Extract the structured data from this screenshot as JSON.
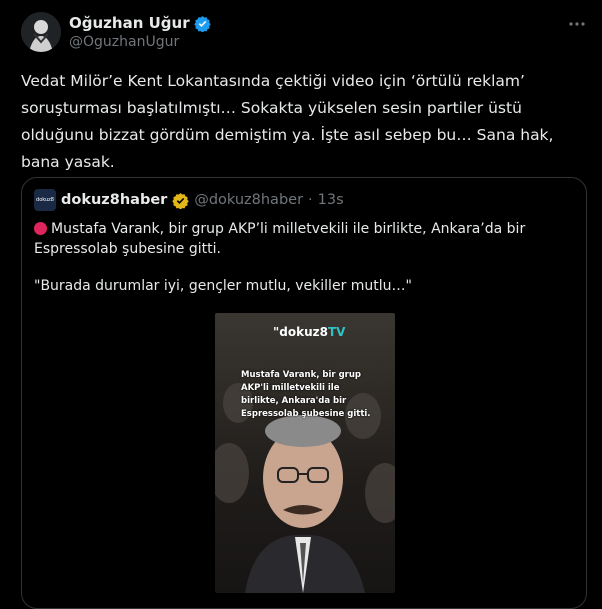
{
  "tweet": {
    "display_name": "Oğuzhan Uğur",
    "handle": "@OguzhanUgur",
    "more_icon": "more-icon",
    "text": "Vedat Milör’e Kent Lokantasında çektiği video için ‘örtülü reklam’ soruşturması başlatılmıştı… Sokakta yükselen sesin partiler üstü olduğunu bizzat gördüm demiştim ya. İşte asıl sebep bu… Sana hak, bana yasak."
  },
  "quote": {
    "avatar_text": "dokuz8",
    "display_name": "dokuz8haber",
    "handle": "@dokuz8haber",
    "separator": "·",
    "time": "13s",
    "line1": "Mustafa Varank, bir grup AKP’li milletvekili ile birlikte, Ankara’da bir Espressolab şubesine gitti.",
    "line2": "\"Burada durumlar iyi, gençler mutlu, vekiller mutlu…\"",
    "video": {
      "logo_main": "\"dokuz8",
      "logo_tv": "TV",
      "caption": "Mustafa Varank, bir grup AKP'li milletvekili ile birlikte, Ankara'da bir Espressolab şubesine gitti."
    }
  },
  "colors": {
    "background": "#000000",
    "text": "#e7e9ea",
    "muted": "#71767b",
    "verified_blue": "#1d9bf0",
    "verified_gold": "#e2b719",
    "border": "#2f3336"
  }
}
